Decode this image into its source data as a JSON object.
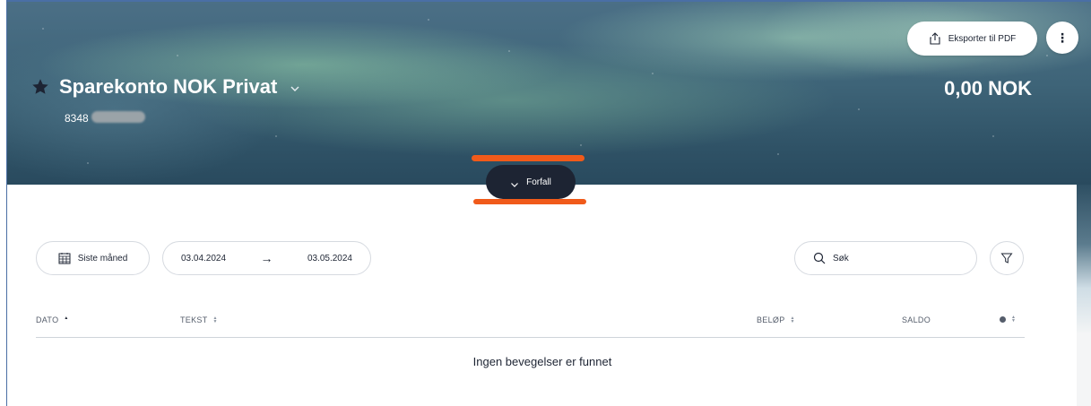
{
  "account": {
    "name": "Sparekonto NOK Privat",
    "number_visible": "8348",
    "balance": "0,00 NOK"
  },
  "header_actions": {
    "export_label": "Eksporter til PDF",
    "more_label": "⋮"
  },
  "toggle": {
    "label": "Forfall"
  },
  "filters": {
    "period_label": "Siste måned",
    "date_from": "03.04.2024",
    "date_arrow": "→",
    "date_to": "03.05.2024",
    "search_placeholder": "Søk"
  },
  "table": {
    "columns": [
      "DATO",
      "TEKST",
      "BELØP",
      "SALDO"
    ],
    "empty_message": "Ingen bevegelser er funnet"
  },
  "colors": {
    "dark_accent": "#1d2433",
    "annotation": "#f05a1a"
  }
}
